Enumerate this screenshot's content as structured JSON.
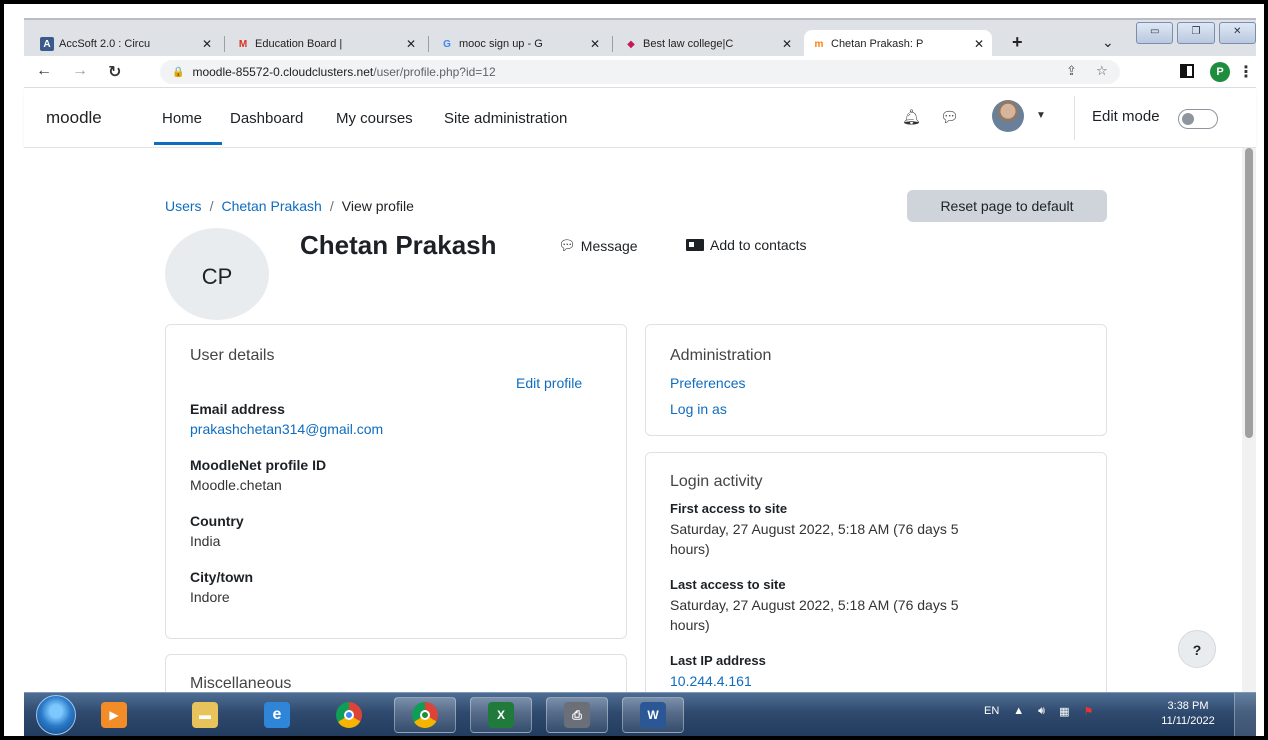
{
  "browser": {
    "tabs": [
      {
        "title": "AccSoft 2.0 : Circu",
        "favicon": "A",
        "favicon_color": "#3a5a8c"
      },
      {
        "title": "Education Board |",
        "favicon": "M",
        "favicon_color": "#d93025"
      },
      {
        "title": "mooc sign up - G",
        "favicon": "G",
        "favicon_color": "#4285f4"
      },
      {
        "title": "Best law college|C",
        "favicon": "◆",
        "favicon_color": "#c2185b"
      },
      {
        "title": "Chetan Prakash: P",
        "favicon": "m",
        "favicon_color": "#f98012"
      }
    ],
    "new_tab": "+",
    "tab_close": "✕",
    "url_host": "moodle-85572-0.cloudclusters.net",
    "url_path": "/user/profile.php?id=12",
    "profile_initial": "P"
  },
  "navbar": {
    "brand": "moodle",
    "links": [
      "Home",
      "Dashboard",
      "My courses",
      "Site administration"
    ],
    "edit_mode": "Edit mode"
  },
  "page": {
    "breadcrumb": [
      "Users",
      "Chetan Prakash",
      "View profile"
    ],
    "reset_button": "Reset page to default",
    "initials": "CP",
    "full_name": "Chetan Prakash",
    "message": "Message",
    "add_contacts": "Add to contacts",
    "user_details": {
      "title": "User details",
      "edit_profile": "Edit profile",
      "email_label": "Email address",
      "email_value": "prakashchetan314@gmail.com",
      "moodlenet_label": "MoodleNet profile ID",
      "moodlenet_value": "Moodle.chetan",
      "country_label": "Country",
      "country_value": "India",
      "city_label": "City/town",
      "city_value": "Indore"
    },
    "administration": {
      "title": "Administration",
      "preferences": "Preferences",
      "login_as": "Log in as"
    },
    "login_activity": {
      "title": "Login activity",
      "first_label": "First access to site",
      "first_value_line1": "Saturday, 27 August 2022, 5:18 AM  (76 days 5",
      "first_value_line2": "hours)",
      "last_label": "Last access to site",
      "last_value_line1": "Saturday, 27 August 2022, 5:18 AM  (76 days 5",
      "last_value_line2": "hours)",
      "ip_label": "Last IP address",
      "ip_value": "10.244.4.161"
    },
    "misc_title": "Miscellaneous",
    "help": "?"
  },
  "taskbar": {
    "lang": "EN",
    "time": "3:38 PM",
    "date": "11/11/2022"
  },
  "colors": {
    "link": "#0f6cbf",
    "taskbar": "#2f4a6e"
  }
}
